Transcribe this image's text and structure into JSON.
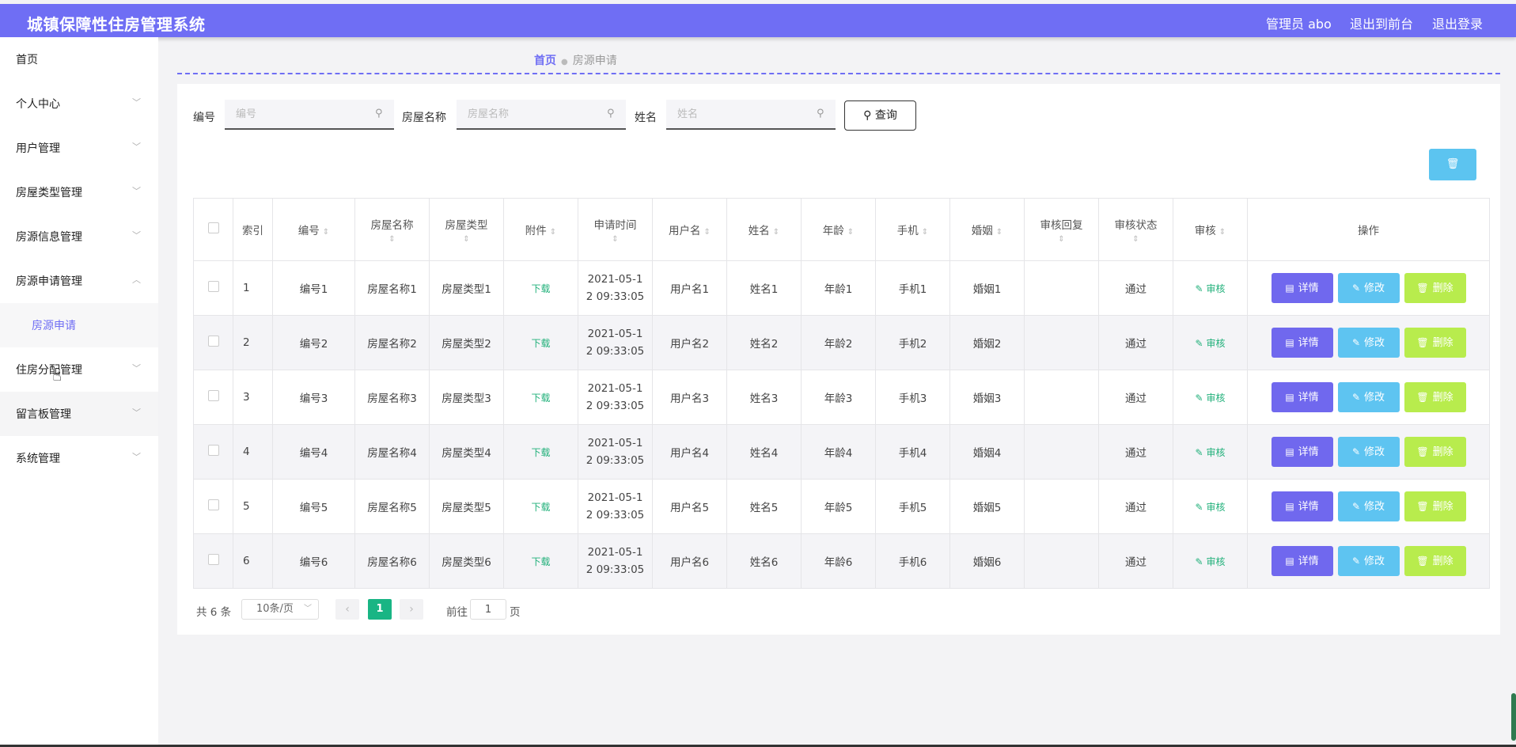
{
  "header": {
    "title": "城镇保障性住房管理系统",
    "user": "管理员 abo",
    "front_link": "退出到前台",
    "logout_link": "退出登录",
    "color": "#6f6ef4"
  },
  "sidebar": {
    "items": [
      {
        "label": "首页",
        "chevron": ""
      },
      {
        "label": "个人中心",
        "chevron": "﹀"
      },
      {
        "label": "用户管理",
        "chevron": "﹀"
      },
      {
        "label": "房屋类型管理",
        "chevron": "﹀"
      },
      {
        "label": "房源信息管理",
        "chevron": "﹀"
      },
      {
        "label": "房源申请管理",
        "chevron": "︿"
      },
      {
        "label": "住房分配管理",
        "chevron": "﹀"
      },
      {
        "label": "留言板管理",
        "chevron": "﹀"
      },
      {
        "label": "系统管理",
        "chevron": "﹀"
      }
    ],
    "sub_active": "房源申请"
  },
  "breadcrumb": {
    "home": "首页",
    "current": "房源申请"
  },
  "search": {
    "fields": [
      {
        "label": "编号",
        "placeholder": "编号"
      },
      {
        "label": "房屋名称",
        "placeholder": "房屋名称"
      },
      {
        "label": "姓名",
        "placeholder": "姓名"
      }
    ],
    "query_label": "查询",
    "search_icon": "magnifier-icon",
    "delete_icon": "trash-icon"
  },
  "table": {
    "columns": [
      "索引",
      "编号",
      "房屋名称",
      "房屋类型",
      "附件",
      "申请时间",
      "用户名",
      "姓名",
      "年龄",
      "手机",
      "婚姻",
      "审核回复",
      "审核状态",
      "审核",
      "操作"
    ],
    "rows": [
      {
        "idx": "1",
        "no": "编号1",
        "name": "房屋名称1",
        "type": "房屋类型1",
        "file": "下载",
        "time": "2021-05-1\n2 09:33:05",
        "user": "用户名1",
        "real": "姓名1",
        "age": "年龄1",
        "phone": "手机1",
        "marriage": "婚姻1",
        "reply": "",
        "status": "通过",
        "audit": "审核"
      },
      {
        "idx": "2",
        "no": "编号2",
        "name": "房屋名称2",
        "type": "房屋类型2",
        "file": "下载",
        "time": "2021-05-1\n2 09:33:05",
        "user": "用户名2",
        "real": "姓名2",
        "age": "年龄2",
        "phone": "手机2",
        "marriage": "婚姻2",
        "reply": "",
        "status": "通过",
        "audit": "审核"
      },
      {
        "idx": "3",
        "no": "编号3",
        "name": "房屋名称3",
        "type": "房屋类型3",
        "file": "下载",
        "time": "2021-05-1\n2 09:33:05",
        "user": "用户名3",
        "real": "姓名3",
        "age": "年龄3",
        "phone": "手机3",
        "marriage": "婚姻3",
        "reply": "",
        "status": "通过",
        "audit": "审核"
      },
      {
        "idx": "4",
        "no": "编号4",
        "name": "房屋名称4",
        "type": "房屋类型4",
        "file": "下载",
        "time": "2021-05-1\n2 09:33:05",
        "user": "用户名4",
        "real": "姓名4",
        "age": "年龄4",
        "phone": "手机4",
        "marriage": "婚姻4",
        "reply": "",
        "status": "通过",
        "audit": "审核"
      },
      {
        "idx": "5",
        "no": "编号5",
        "name": "房屋名称5",
        "type": "房屋类型5",
        "file": "下载",
        "time": "2021-05-1\n2 09:33:05",
        "user": "用户名5",
        "real": "姓名5",
        "age": "年龄5",
        "phone": "手机5",
        "marriage": "婚姻5",
        "reply": "",
        "status": "通过",
        "audit": "审核"
      },
      {
        "idx": "6",
        "no": "编号6",
        "name": "房屋名称6",
        "type": "房屋类型6",
        "file": "下载",
        "time": "2021-05-1\n2 09:33:05",
        "user": "用户名6",
        "real": "姓名6",
        "age": "年龄6",
        "phone": "手机6",
        "marriage": "婚姻6",
        "reply": "",
        "status": "通过",
        "audit": "审核"
      }
    ],
    "actions": {
      "detail": "详情",
      "edit": "修改",
      "delete": "删除"
    }
  },
  "pagination": {
    "total": "共 6 条",
    "page_size": "10条/页",
    "current": "1",
    "goto_prefix": "前往",
    "goto_value": "1",
    "goto_suffix": "页"
  }
}
